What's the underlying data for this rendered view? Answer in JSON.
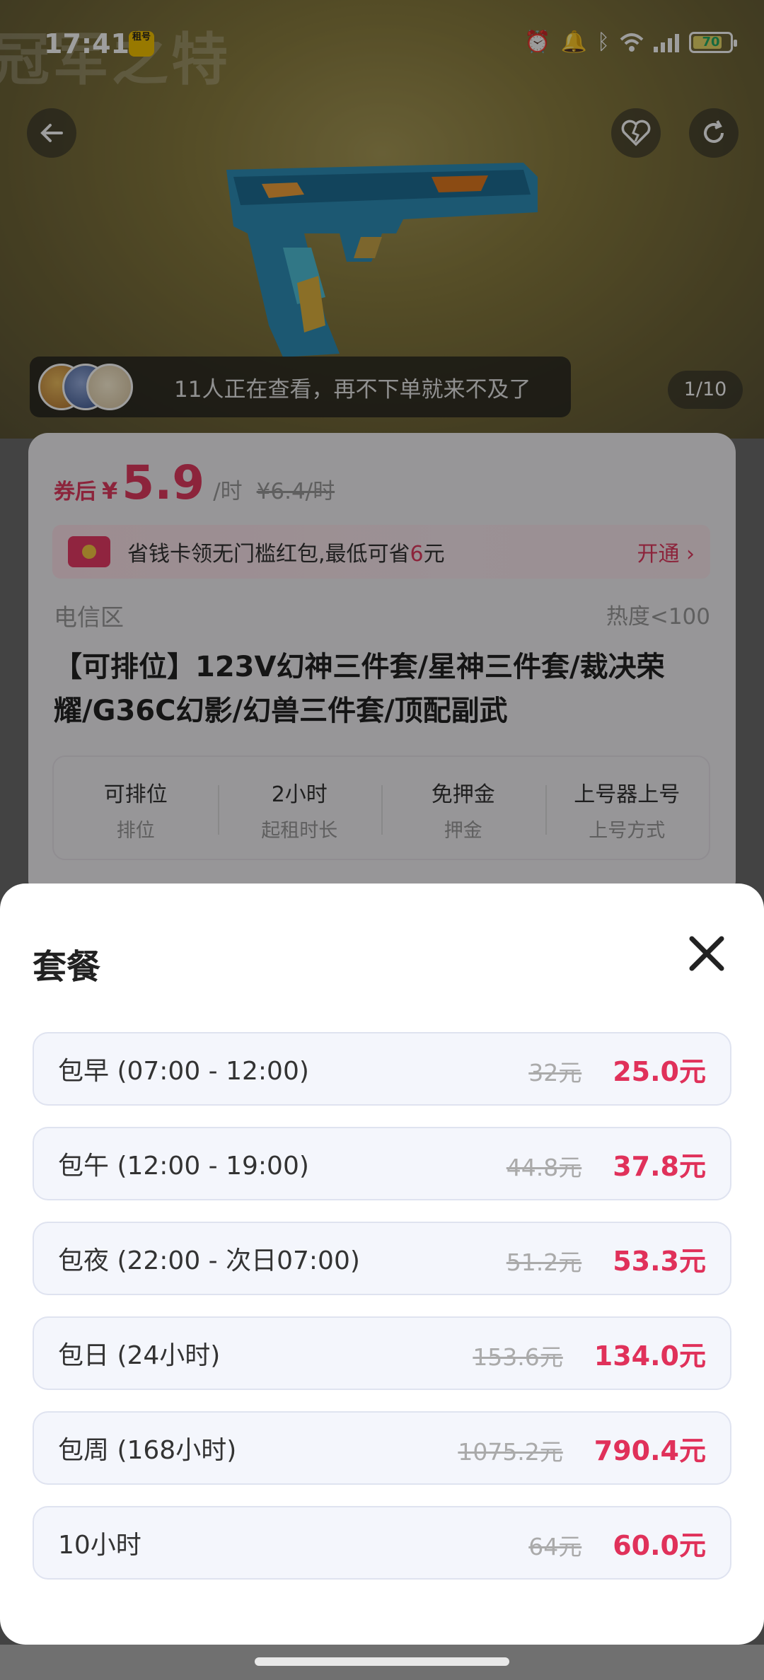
{
  "status_bar": {
    "time": "17:41",
    "app_badge": "租号",
    "battery": "70"
  },
  "hero": {
    "ghost_title": "冠军之特",
    "viewers_text": "11人正在查看，再不下单就来不及了",
    "pager": "1/10"
  },
  "product": {
    "price_tag": "券后",
    "price_yen": "¥",
    "price": "5.9",
    "price_unit": "/时",
    "price_old": "¥6.4/时",
    "promo_text": "省钱卡领无门槛红包,最低可省",
    "promo_amount": "6",
    "promo_suffix": "元",
    "promo_action": "开通",
    "region": "电信区",
    "heat": "热度<100",
    "title": "【可排位】123V幻神三件套/星神三件套/裁决荣耀/G36C幻影/幻兽三件套/顶配副武",
    "attributes": [
      {
        "value": "可排位",
        "key": "排位"
      },
      {
        "value": "2小时",
        "key": "起租时长"
      },
      {
        "value": "免押金",
        "key": "押金"
      },
      {
        "value": "上号器上号",
        "key": "上号方式"
      }
    ]
  },
  "sheet": {
    "title": "套餐",
    "plans": [
      {
        "name": "包早 (07:00 - 12:00)",
        "old": "32元",
        "new": "25.0元"
      },
      {
        "name": "包午 (12:00 - 19:00)",
        "old": "44.8元",
        "new": "37.8元"
      },
      {
        "name": "包夜 (22:00 - 次日07:00)",
        "old": "51.2元",
        "new": "53.3元"
      },
      {
        "name": "包日 (24小时)",
        "old": "153.6元",
        "new": "134.0元"
      },
      {
        "name": "包周 (168小时)",
        "old": "1075.2元",
        "new": "790.4元"
      },
      {
        "name": "10小时",
        "old": "64元",
        "new": "60.0元"
      }
    ]
  },
  "colors": {
    "accent": "#e0315a",
    "plan_bg": "#f4f6fc"
  },
  "icons": [
    "back-arrow-icon",
    "broken-heart-icon",
    "refresh-icon",
    "close-icon",
    "alarm-icon",
    "bell-icon",
    "bluetooth-icon",
    "wifi-icon",
    "signal-icon",
    "battery-icon"
  ]
}
